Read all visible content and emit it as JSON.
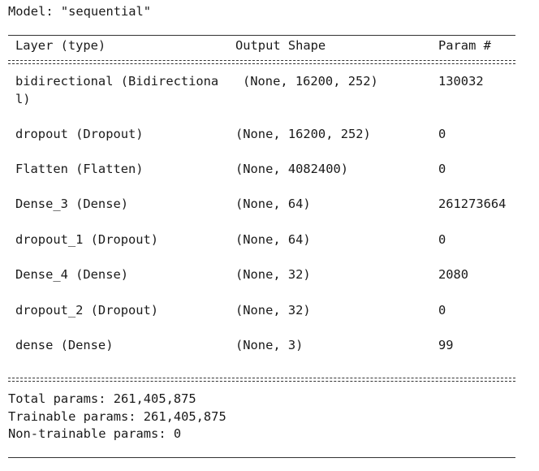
{
  "model": {
    "title": "Model: \"sequential\""
  },
  "table": {
    "headers": {
      "layer": "Layer (type)",
      "shape": "Output Shape",
      "params": "Param #"
    },
    "rows": [
      {
        "layer": "bidirectional (Bidirectiona\nl)",
        "shape": "(None, 16200, 252)",
        "params": "130032"
      },
      {
        "layer": "dropout (Dropout)",
        "shape": "(None, 16200, 252)",
        "params": "0"
      },
      {
        "layer": "Flatten (Flatten)",
        "shape": "(None, 4082400)",
        "params": "0"
      },
      {
        "layer": "Dense_3 (Dense)",
        "shape": "(None, 64)",
        "params": "261273664"
      },
      {
        "layer": "dropout_1 (Dropout)",
        "shape": "(None, 64)",
        "params": "0"
      },
      {
        "layer": "Dense_4 (Dense)",
        "shape": "(None, 32)",
        "params": "2080"
      },
      {
        "layer": "dropout_2 (Dropout)",
        "shape": "(None, 32)",
        "params": "0"
      },
      {
        "layer": "dense (Dense)",
        "shape": "(None, 3)",
        "params": "99"
      }
    ]
  },
  "summary": {
    "total": "Total params: 261,405,875",
    "trainable": "Trainable params: 261,405,875",
    "non_trainable": "Non-trainable params: 0"
  }
}
